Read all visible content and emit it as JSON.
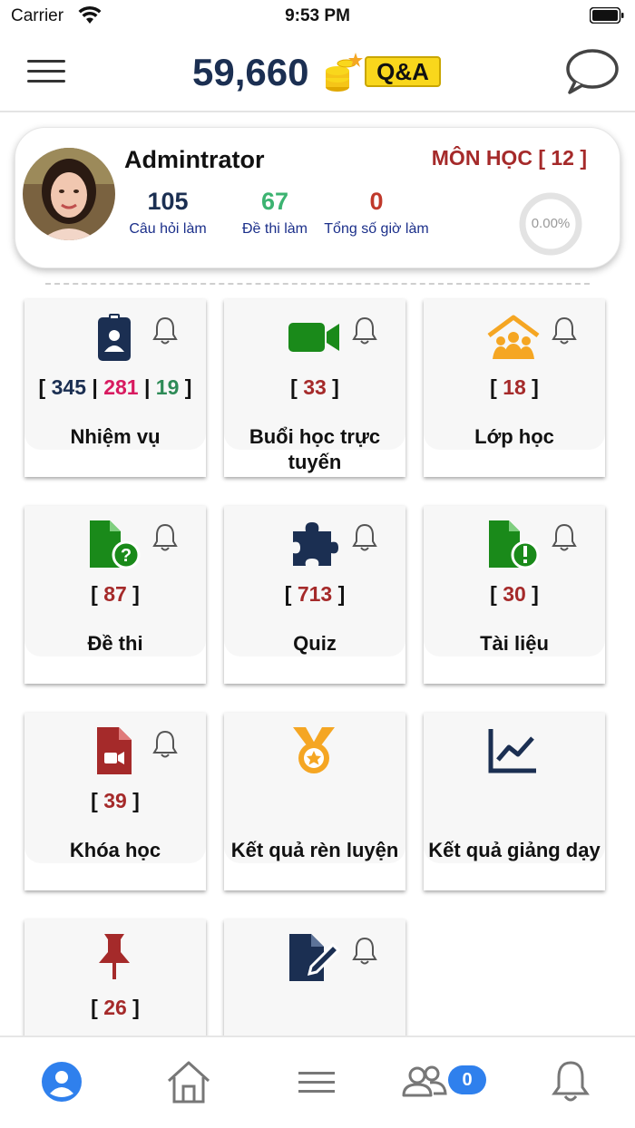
{
  "status_bar": {
    "carrier": "Carrier",
    "time": "9:53 PM"
  },
  "header": {
    "points": "59,660",
    "qa_label": "Q&A",
    "icons": [
      "menu-icon",
      "coins-icon",
      "chat-icon"
    ]
  },
  "profile": {
    "name": "Admintrator",
    "subjects_label": "MÔN HỌC [ 12 ]",
    "stats": [
      {
        "value": "105",
        "label": "Câu hỏi làm"
      },
      {
        "value": "67",
        "label": "Đề thi làm"
      },
      {
        "value": "0",
        "label": "Tổng số giờ làm"
      }
    ],
    "progress": "0.00%",
    "progress_value": 0
  },
  "tiles": [
    {
      "label": "Nhiệm vụ",
      "counts": [
        "345",
        "281",
        "19"
      ],
      "icon": "badge-icon",
      "bell": true
    },
    {
      "label": "Buổi học trực tuyến",
      "count": "33",
      "icon": "video-camera-icon",
      "bell": true
    },
    {
      "label": "Lớp học",
      "count": "18",
      "icon": "classroom-icon",
      "bell": true
    },
    {
      "label": "Đề thi",
      "count": "87",
      "icon": "exam-file-icon",
      "bell": true
    },
    {
      "label": "Quiz",
      "count": "713",
      "icon": "puzzle-icon",
      "bell": true
    },
    {
      "label": "Tài liệu",
      "count": "30",
      "icon": "document-alert-icon",
      "bell": true
    },
    {
      "label": "Khóa học",
      "count": "39",
      "icon": "video-file-icon",
      "bell": true
    },
    {
      "label": "Kết quả rèn luyện",
      "count": "",
      "icon": "medal-icon",
      "bell": false
    },
    {
      "label": "Kết quả giảng dạy",
      "count": "",
      "icon": "line-chart-icon",
      "bell": false
    },
    {
      "label": "",
      "count": "26",
      "icon": "pin-icon",
      "bell": false
    },
    {
      "label": "",
      "count": "",
      "icon": "file-edit-icon",
      "bell": true
    }
  ],
  "bottom_nav": {
    "items": [
      "profile-icon",
      "home-icon",
      "menu-icon",
      "group-icon",
      "bell-icon"
    ],
    "group_badge": "0"
  },
  "colors": {
    "navy": "#1b2f52",
    "red": "#a52a2a",
    "green": "#2e8b57",
    "orange": "#f5a623",
    "blue": "#2f80ed"
  }
}
